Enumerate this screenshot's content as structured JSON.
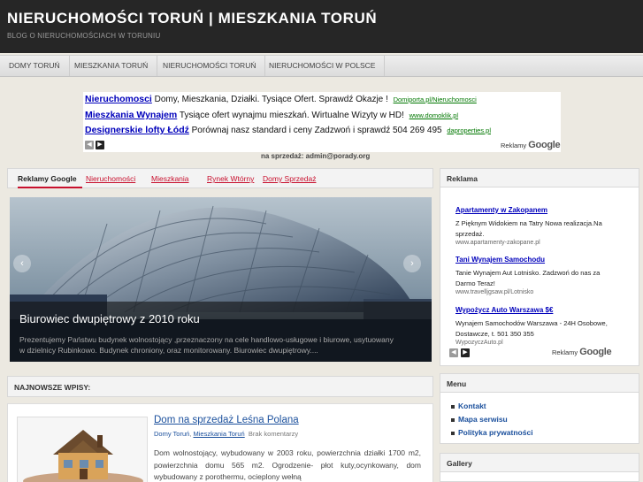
{
  "header": {
    "title": "NIERUCHOMOŚCI TORUŃ | MIESZKANIA TORUŃ",
    "description": "BLOG O NIERUCHOMOŚCIACH W TORUNIU"
  },
  "nav": {
    "items": [
      "DOMY TORUŃ",
      "MIESZKANIA TORUŃ",
      "NIERUCHOMOŚCI TORUŃ",
      "NIERUCHOMOŚCI W POLSCE"
    ]
  },
  "top_ads": {
    "items": [
      {
        "title": "Nieruchomosci",
        "text": "Domy, Mieszkania, Działki. Tysiące Ofert. Sprawdź Okazje !",
        "url": "Domiporta.pl/Nieruchomosci"
      },
      {
        "title": "Mieszkania Wynajem",
        "text": "Tysiące ofert wynajmu mieszkań. Wirtualne Wizyty w HD!",
        "url": "www.domoklik.pl"
      },
      {
        "title": "Designerskie lofty Łódź",
        "text": "Porównaj nasz standard i ceny Zadzwoń i sprawdź 504 269 495",
        "url": "daproperties.pl"
      }
    ],
    "brand_prefix": "Reklamy",
    "brand": "Google"
  },
  "sale_note": "na sprzedaż: admin@porady.org",
  "tabs": {
    "first": "Reklamy Google",
    "links": [
      "Nieruchomości",
      "Mieszkania",
      "Rynek Wtórny",
      "Domy Sprzedaż"
    ]
  },
  "slider": {
    "title": "Biurowiec dwupiętrowy z 2010 roku",
    "text": "Prezentujemy Państwu budynek wolnostojący ,przeznaczony na cele handlowo-usługowe i biurowe, usytuowany w dzielnicy Rubinkowo. Budynek chroniony, oraz monitorowany. Biurowiec dwupiętrowy....",
    "prev": "‹",
    "next": "›"
  },
  "latest": {
    "heading": "NAJNOWSZE WPISY:"
  },
  "post": {
    "title": "Dom na sprzedaż Leśna Polana",
    "category1": "Domy Toruń",
    "separator": ",",
    "category2": "Mieszkania Toruń",
    "comments": "Brak komentarzy",
    "excerpt": "Dom wolnostojący, wybudowany w 2003 roku, powierzchnia działki 1700 m2, powierzchnia domu 565 m2. Ogrodzenie- płot kuty,ocynkowany, dom wybudowany z porothermu, ocieplony wełną"
  },
  "sidebar": {
    "reklama": {
      "title": "Reklama",
      "ads": [
        {
          "title": "Apartamenty w Zakopanem",
          "text": "Z Pięknym Widokiem na Tatry Nowa realizacja.Na sprzedaż.",
          "url": "www.apartamenty-zakopane.pl"
        },
        {
          "title": "Tani Wynajem Samochodu",
          "text": "Tanie Wynajem Aut Lotnisko. Zadzwoń do nas za Darmo Teraz!",
          "url": "www.travelljgsaw.pl/Lotnisko"
        },
        {
          "title": "Wypożycz Auto Warszawa $€",
          "text": "Wynajem Samochodów Warszawa - 24H Osobowe, Dostawcze, t. 501 350 355",
          "url": "WypozyczAuto.pl"
        }
      ],
      "brand_prefix": "Reklamy",
      "brand": "Google"
    },
    "menu": {
      "title": "Menu",
      "items": [
        "Kontakt",
        "Mapa serwisu",
        "Polityka prywatności"
      ]
    },
    "gallery": {
      "title": "Gallery"
    }
  },
  "colors": {
    "header_bg": "#262626",
    "page_bg": "#ece9e1",
    "tab_link": "#c8102e",
    "post_link": "#1a4f9c",
    "ad_title": "#0000bb",
    "ad_url": "#007700"
  }
}
